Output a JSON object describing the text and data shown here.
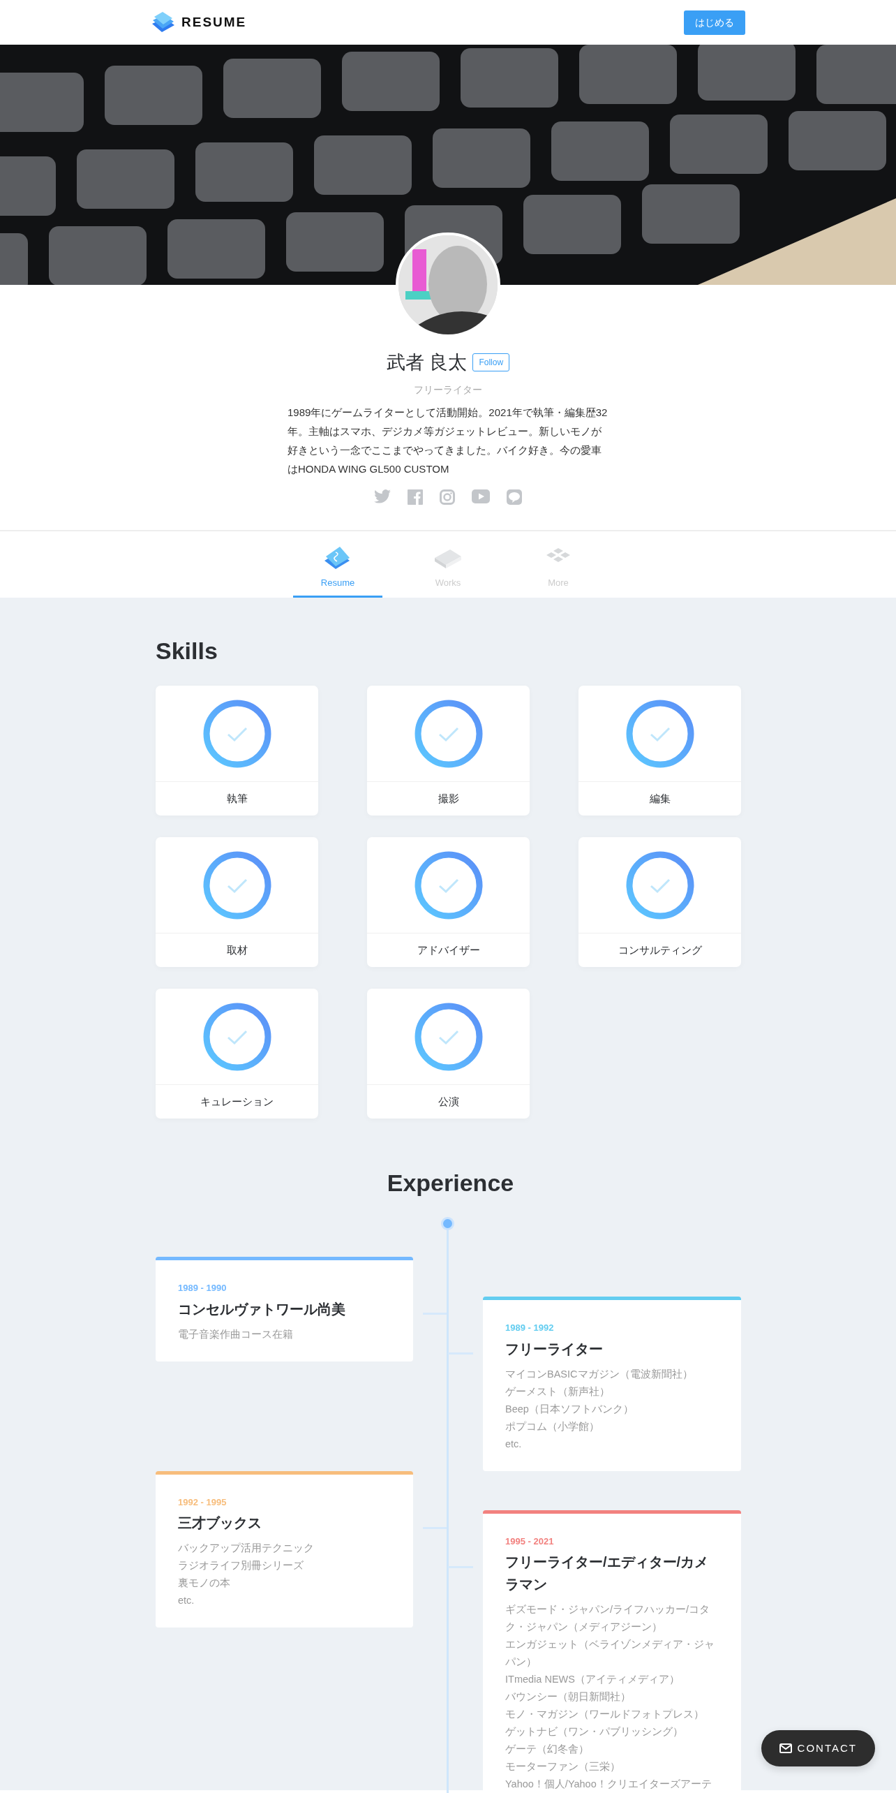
{
  "header": {
    "logo": "RESUME",
    "button": "はじめる"
  },
  "profile": {
    "name": "武者 良太",
    "follow": "Follow",
    "role": "フリーライター",
    "bio": "1989年にゲームライターとして活動開始。2021年で執筆・編集歴32年。主軸はスマホ、デジカメ等ガジェットレビュー。新しいモノが好きという一念でここまでやってきました。バイク好き。今の愛車はHONDA WING GL500 CUSTOM"
  },
  "tabs": [
    {
      "label": "Resume",
      "selected": true
    },
    {
      "label": "Works",
      "selected": false
    },
    {
      "label": "More",
      "selected": false
    }
  ],
  "skills": {
    "title": "Skills",
    "items": [
      "執筆",
      "撮影",
      "編集",
      "取材",
      "アドバイザー",
      "コンサルティング",
      "キュレーション",
      "公演"
    ]
  },
  "experience": {
    "title": "Experience",
    "items": [
      {
        "period": "1989 - 1990",
        "title": "コンセルヴァトワール尚美",
        "color": "#74b9ff",
        "details": [
          "電子音楽作曲コース在籍"
        ]
      },
      {
        "period": "1989 - 1992",
        "title": "フリーライター",
        "color": "#63cdf0",
        "details": [
          "マイコンBASICマガジン（電波新聞社）",
          "ゲーメスト（新声社）",
          "Beep（日本ソフトバンク）",
          "ポプコム（小学館）",
          "etc."
        ]
      },
      {
        "period": "1992 - 1995",
        "title": "三才ブックス",
        "color": "#f7bd7c",
        "details": [
          "バックアップ活用テクニック",
          "ラジオライフ別冊シリーズ",
          "裏モノの本",
          "etc."
        ]
      },
      {
        "period": "1995 - 2021",
        "title": "フリーライター/エディター/カメラマン",
        "color": "#f2817f",
        "details": [
          "ギズモード・ジャパン/ライフハッカー/コタク・ジャパン（メディアジーン）",
          "エンガジェット（ベライゾンメディア・ジャパン）",
          "ITmedia NEWS（アイティメディア）",
          "バウンシー（朝日新聞社）",
          "モノ・マガジン（ワールドフォトプレス）",
          "ゲットナビ（ワン・パブリッシング）",
          "ゲーテ（幻冬舎）",
          "モーターファン（三栄）",
          "Yahoo！個人/Yahoo！クリエイターズアーテ"
        ]
      }
    ]
  },
  "contact_button": "CONTACT"
}
